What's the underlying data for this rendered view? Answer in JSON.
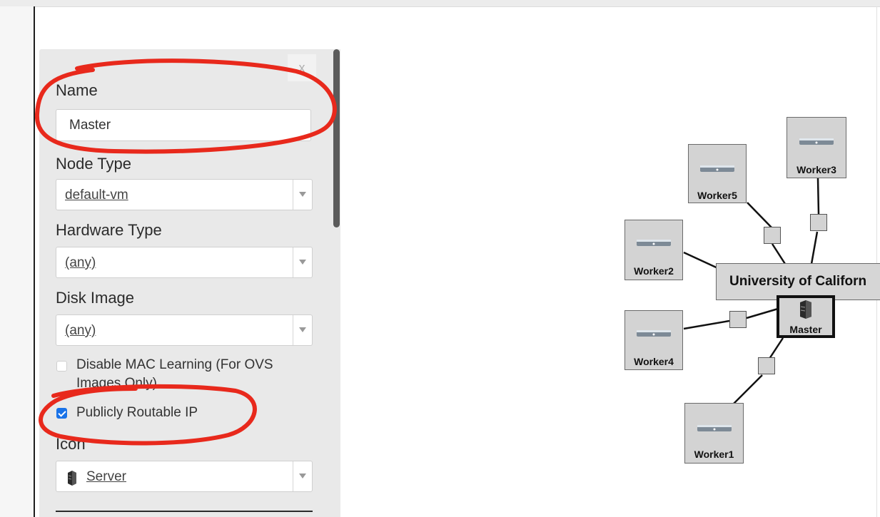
{
  "panel": {
    "close_label": "x",
    "name_label": "Name",
    "name_value": "Master",
    "node_type_label": "Node Type",
    "node_type_value": "default-vm",
    "hardware_type_label": "Hardware Type",
    "hardware_type_value": "(any)",
    "disk_image_label": "Disk Image",
    "disk_image_value": "(any)",
    "disable_mac_label_line1": "Disable MAC Learning (For OVS",
    "disable_mac_label_line2": "Images Only)",
    "disable_mac_checked": false,
    "public_ip_label": "Publicly Routable IP",
    "public_ip_checked": true,
    "icon_label": "Icon",
    "icon_value": "Server",
    "icon_name": "server-icon"
  },
  "graph": {
    "site_label": "University of Californ",
    "nodes": {
      "worker1": "Worker1",
      "worker2": "Worker2",
      "worker3": "Worker3",
      "worker4": "Worker4",
      "worker5": "Worker5",
      "master": "Master"
    }
  },
  "colors": {
    "annotation": "#e8291c",
    "checkbox_checked": "#1a73e8",
    "panel_bg": "#e9e9e9",
    "node_bg": "#d3d3d3"
  }
}
